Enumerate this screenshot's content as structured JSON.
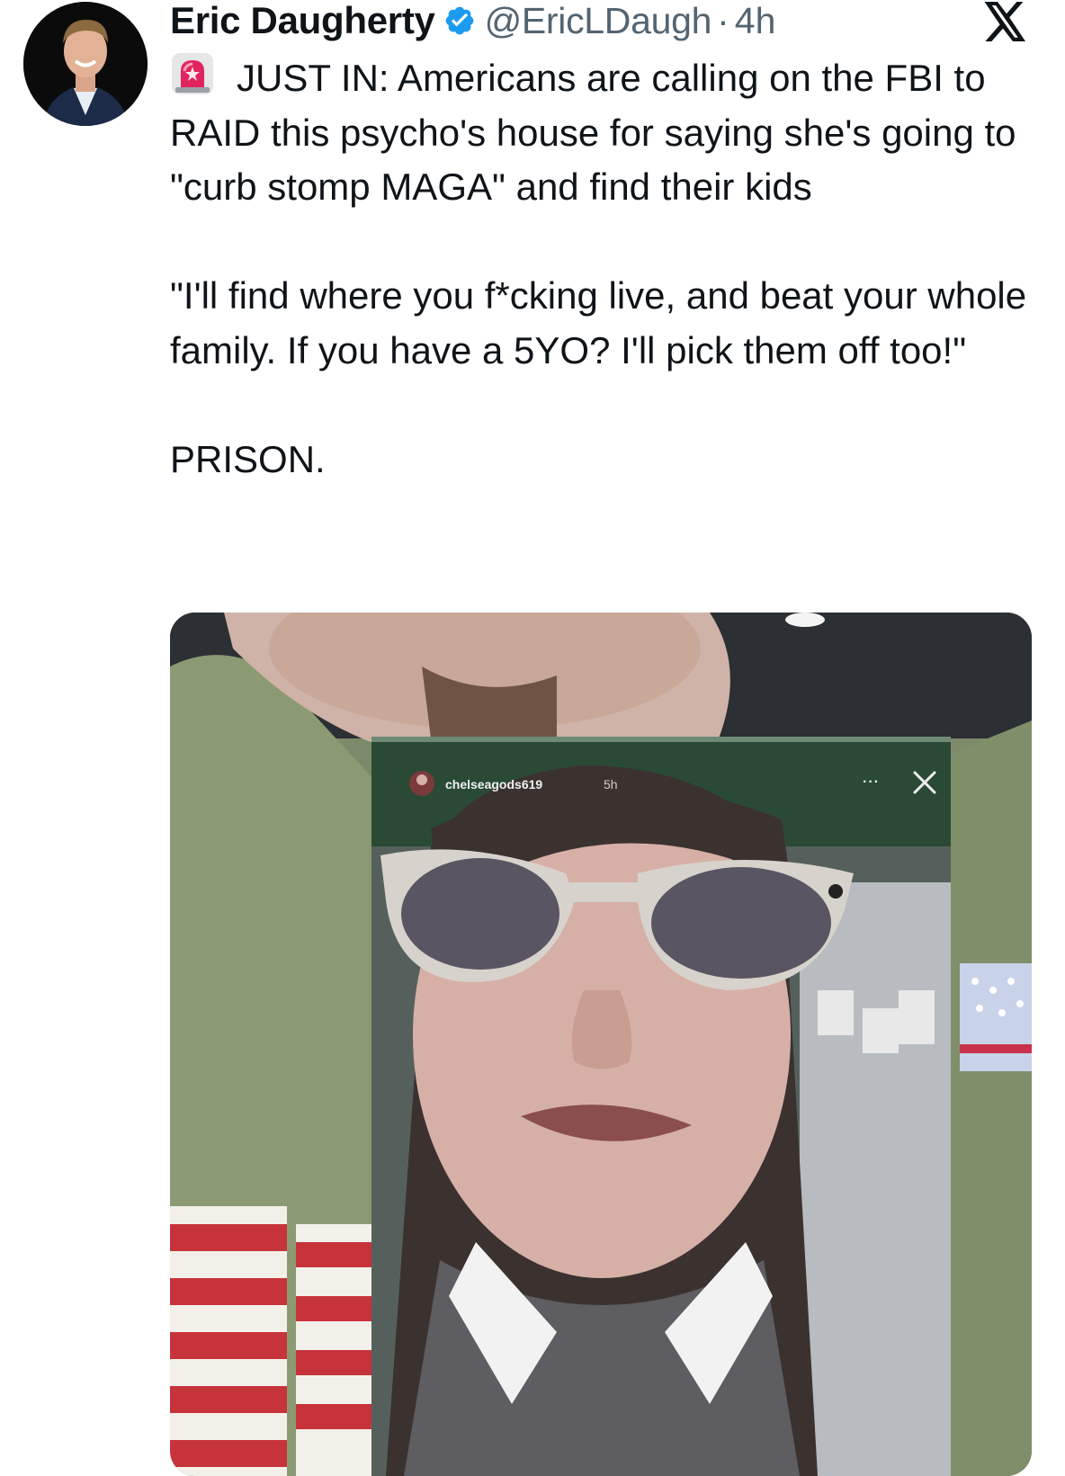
{
  "tweet": {
    "author": {
      "display_name": "Eric Daugherty",
      "handle": "@EricLDaugh",
      "verified_icon": "verified-badge-icon",
      "avatar_icon": "avatar"
    },
    "separator": "·",
    "timestamp": "4h",
    "platform_icon": "x-logo-icon",
    "lines": {
      "p1_text": "JUST IN: Americans are calling on the FBI to RAID this psycho's house for saying she's going to \"curb stomp MAGA\" and find their kids",
      "p2": "\"I'll find where you f*cking live, and beat your whole family. If you have a 5YO? I'll pick them off too!\"",
      "p3": "PRISON."
    },
    "emoji_icon": "police-siren-icon",
    "media": {
      "overlay_username": "chelseagods619",
      "overlay_time": "5h",
      "overlay_dots": "···"
    }
  },
  "colors": {
    "text_primary": "#0f1419",
    "text_secondary": "#536471",
    "verified_blue": "#1d9bf0",
    "siren_red": "#e0245e"
  }
}
